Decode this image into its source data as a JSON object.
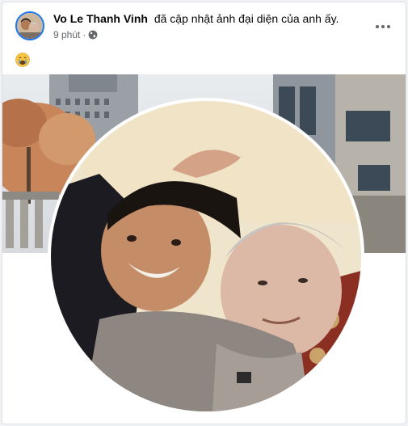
{
  "post": {
    "author_name": "Vo Le Thanh Vinh",
    "action_text": "đã cập nhật ảnh đại diện của anh ấy.",
    "timestamp": "9 phút",
    "separator": "·",
    "privacy_icon": "globe-icon",
    "more_icon": "more-options-icon",
    "body_emoji": "crying-face-emoji"
  },
  "colors": {
    "accent": "#1877f2",
    "secondary_text": "#65676b",
    "primary_text": "#050505",
    "card_background": "#ffffff"
  },
  "media": {
    "cover_photo": "city-buildings-autumn-tree",
    "profile_photo": "young-man-and-elderly-man-selfie"
  }
}
